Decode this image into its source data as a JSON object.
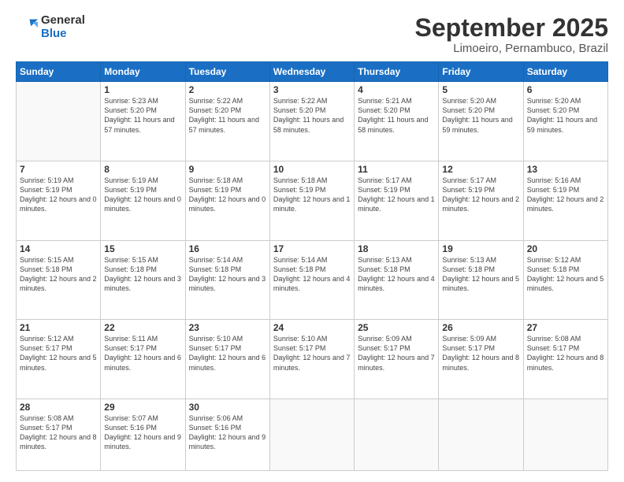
{
  "logo": {
    "general": "General",
    "blue": "Blue"
  },
  "title": "September 2025",
  "location": "Limoeiro, Pernambuco, Brazil",
  "days_header": [
    "Sunday",
    "Monday",
    "Tuesday",
    "Wednesday",
    "Thursday",
    "Friday",
    "Saturday"
  ],
  "weeks": [
    [
      {
        "day": "",
        "info": ""
      },
      {
        "day": "1",
        "info": "Sunrise: 5:23 AM\nSunset: 5:20 PM\nDaylight: 11 hours\nand 57 minutes."
      },
      {
        "day": "2",
        "info": "Sunrise: 5:22 AM\nSunset: 5:20 PM\nDaylight: 11 hours\nand 57 minutes."
      },
      {
        "day": "3",
        "info": "Sunrise: 5:22 AM\nSunset: 5:20 PM\nDaylight: 11 hours\nand 58 minutes."
      },
      {
        "day": "4",
        "info": "Sunrise: 5:21 AM\nSunset: 5:20 PM\nDaylight: 11 hours\nand 58 minutes."
      },
      {
        "day": "5",
        "info": "Sunrise: 5:20 AM\nSunset: 5:20 PM\nDaylight: 11 hours\nand 59 minutes."
      },
      {
        "day": "6",
        "info": "Sunrise: 5:20 AM\nSunset: 5:20 PM\nDaylight: 11 hours\nand 59 minutes."
      }
    ],
    [
      {
        "day": "7",
        "info": "Sunrise: 5:19 AM\nSunset: 5:19 PM\nDaylight: 12 hours\nand 0 minutes."
      },
      {
        "day": "8",
        "info": "Sunrise: 5:19 AM\nSunset: 5:19 PM\nDaylight: 12 hours\nand 0 minutes."
      },
      {
        "day": "9",
        "info": "Sunrise: 5:18 AM\nSunset: 5:19 PM\nDaylight: 12 hours\nand 0 minutes."
      },
      {
        "day": "10",
        "info": "Sunrise: 5:18 AM\nSunset: 5:19 PM\nDaylight: 12 hours\nand 1 minute."
      },
      {
        "day": "11",
        "info": "Sunrise: 5:17 AM\nSunset: 5:19 PM\nDaylight: 12 hours\nand 1 minute."
      },
      {
        "day": "12",
        "info": "Sunrise: 5:17 AM\nSunset: 5:19 PM\nDaylight: 12 hours\nand 2 minutes."
      },
      {
        "day": "13",
        "info": "Sunrise: 5:16 AM\nSunset: 5:19 PM\nDaylight: 12 hours\nand 2 minutes."
      }
    ],
    [
      {
        "day": "14",
        "info": "Sunrise: 5:15 AM\nSunset: 5:18 PM\nDaylight: 12 hours\nand 2 minutes."
      },
      {
        "day": "15",
        "info": "Sunrise: 5:15 AM\nSunset: 5:18 PM\nDaylight: 12 hours\nand 3 minutes."
      },
      {
        "day": "16",
        "info": "Sunrise: 5:14 AM\nSunset: 5:18 PM\nDaylight: 12 hours\nand 3 minutes."
      },
      {
        "day": "17",
        "info": "Sunrise: 5:14 AM\nSunset: 5:18 PM\nDaylight: 12 hours\nand 4 minutes."
      },
      {
        "day": "18",
        "info": "Sunrise: 5:13 AM\nSunset: 5:18 PM\nDaylight: 12 hours\nand 4 minutes."
      },
      {
        "day": "19",
        "info": "Sunrise: 5:13 AM\nSunset: 5:18 PM\nDaylight: 12 hours\nand 5 minutes."
      },
      {
        "day": "20",
        "info": "Sunrise: 5:12 AM\nSunset: 5:18 PM\nDaylight: 12 hours\nand 5 minutes."
      }
    ],
    [
      {
        "day": "21",
        "info": "Sunrise: 5:12 AM\nSunset: 5:17 PM\nDaylight: 12 hours\nand 5 minutes."
      },
      {
        "day": "22",
        "info": "Sunrise: 5:11 AM\nSunset: 5:17 PM\nDaylight: 12 hours\nand 6 minutes."
      },
      {
        "day": "23",
        "info": "Sunrise: 5:10 AM\nSunset: 5:17 PM\nDaylight: 12 hours\nand 6 minutes."
      },
      {
        "day": "24",
        "info": "Sunrise: 5:10 AM\nSunset: 5:17 PM\nDaylight: 12 hours\nand 7 minutes."
      },
      {
        "day": "25",
        "info": "Sunrise: 5:09 AM\nSunset: 5:17 PM\nDaylight: 12 hours\nand 7 minutes."
      },
      {
        "day": "26",
        "info": "Sunrise: 5:09 AM\nSunset: 5:17 PM\nDaylight: 12 hours\nand 8 minutes."
      },
      {
        "day": "27",
        "info": "Sunrise: 5:08 AM\nSunset: 5:17 PM\nDaylight: 12 hours\nand 8 minutes."
      }
    ],
    [
      {
        "day": "28",
        "info": "Sunrise: 5:08 AM\nSunset: 5:17 PM\nDaylight: 12 hours\nand 8 minutes."
      },
      {
        "day": "29",
        "info": "Sunrise: 5:07 AM\nSunset: 5:16 PM\nDaylight: 12 hours\nand 9 minutes."
      },
      {
        "day": "30",
        "info": "Sunrise: 5:06 AM\nSunset: 5:16 PM\nDaylight: 12 hours\nand 9 minutes."
      },
      {
        "day": "",
        "info": ""
      },
      {
        "day": "",
        "info": ""
      },
      {
        "day": "",
        "info": ""
      },
      {
        "day": "",
        "info": ""
      }
    ]
  ]
}
